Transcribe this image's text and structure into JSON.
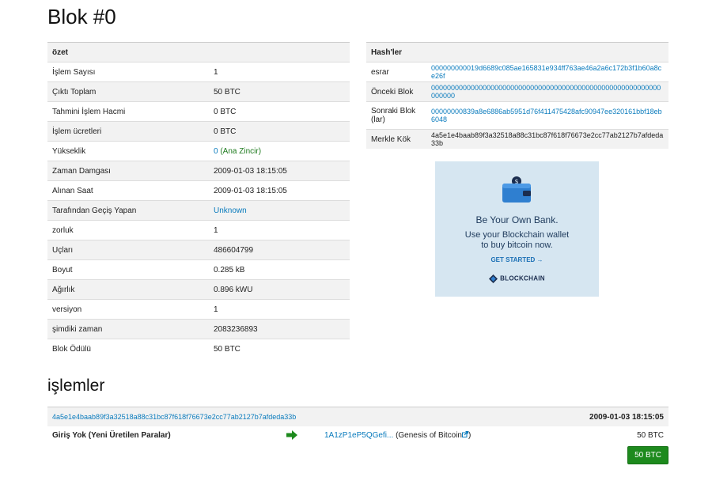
{
  "title": "Blok #0",
  "summary": {
    "header": "özet",
    "rows": [
      {
        "label": "İşlem Sayısı",
        "value": "1"
      },
      {
        "label": "Çıktı Toplam",
        "value": "50 BTC"
      },
      {
        "label": "Tahmini İşlem Hacmi",
        "value": "0 BTC"
      },
      {
        "label": "İşlem ücretleri",
        "value": "0 BTC"
      },
      {
        "label": "Yükseklik",
        "value": "0",
        "extra": "(Ana Zincir)"
      },
      {
        "label": "Zaman Damgası",
        "value": "2009-01-03 18:15:05"
      },
      {
        "label": "Alınan Saat",
        "value": "2009-01-03 18:15:05"
      },
      {
        "label": "Tarafından Geçiş Yapan",
        "value": "Unknown"
      },
      {
        "label": "zorluk",
        "value": "1"
      },
      {
        "label": "Uçları",
        "value": "486604799"
      },
      {
        "label": "Boyut",
        "value": "0.285 kB"
      },
      {
        "label": "Ağırlık",
        "value": "0.896 kWU"
      },
      {
        "label": "versiyon",
        "value": "1"
      },
      {
        "label": "şimdiki zaman",
        "value": "2083236893"
      },
      {
        "label": "Blok Ödülü",
        "value": "50 BTC"
      }
    ]
  },
  "hashes": {
    "header": "Hash'ler",
    "rows": [
      {
        "label": "esrar",
        "value": "000000000019d6689c085ae165831e934ff763ae46a2a6c172b3f1b60a8ce26f"
      },
      {
        "label": "Önceki Blok",
        "value": "0000000000000000000000000000000000000000000000000000000000000000"
      },
      {
        "label": "Sonraki Blok (lar)",
        "value": "00000000839a8e6886ab5951d76f411475428afc90947ee320161bbf18eb6048"
      },
      {
        "label": "Merkle Kök",
        "value": "4a5e1e4baab89f3a32518a88c31bc87f618f76673e2cc77ab2127b7afdeda33b"
      }
    ]
  },
  "ad": {
    "line1": "Be Your Own Bank.",
    "line2": "Use your Blockchain wallet",
    "line3": "to buy bitcoin now.",
    "cta": "GET STARTED →",
    "brand": "BLOCKCHAIN",
    "bg_color": "#d6e6f1"
  },
  "transactions": {
    "heading": "işlemler",
    "hash": "4a5e1e4baab89f3a32518a88c31bc87f618f76673e2cc77ab2127b7afdeda33b",
    "date": "2009-01-03 18:15:05",
    "from": "Giriş Yok (Yeni Üretilen Paralar)",
    "to_address": "1A1zP1eP5QGefi...",
    "to_label": "(Genesis of Bitcoin",
    "to_label_close": ")",
    "amount": "50 BTC",
    "total": "50 BTC",
    "arrow_icon": "right-arrow-icon",
    "arrow_color": "#1d8a1d"
  }
}
